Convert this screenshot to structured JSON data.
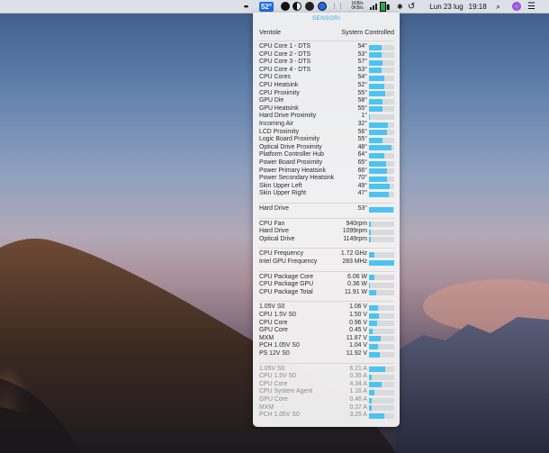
{
  "menubar": {
    "more_glyph": "••",
    "temp": "52°",
    "net_up": "1KB/s",
    "net_down": "0KB/s",
    "date": "Lun 23 lug",
    "time": "19:18",
    "icons": [
      "more-icon",
      "temperature-badge",
      "clock-icon",
      "theme-icon",
      "disk-icon",
      "globe-icon",
      "cpu-icon",
      "network-icon",
      "signal-icon",
      "battery-icon",
      "memory-icon",
      "bluetooth-icon",
      "timemachine-icon",
      "search-icon",
      "siri-icon",
      "notifications-icon"
    ]
  },
  "popup": {
    "title": "SENSORI",
    "fan_label": "Ventole",
    "fan_mode": "System Controlled",
    "groups": [
      {
        "rows": [
          {
            "label": "CPU Core 1 - DTS",
            "value": "54°",
            "level": 0.5
          },
          {
            "label": "CPU Core 2 - DTS",
            "value": "53°",
            "level": 0.49
          },
          {
            "label": "CPU Core 3 - DTS",
            "value": "57°",
            "level": 0.52
          },
          {
            "label": "CPU Core 4 - DTS",
            "value": "53°",
            "level": 0.49
          },
          {
            "label": "CPU Cores",
            "value": "54°",
            "level": 0.62
          },
          {
            "label": "CPU Heatsink",
            "value": "52°",
            "level": 0.6
          },
          {
            "label": "CPU Proximity",
            "value": "55°",
            "level": 0.63
          },
          {
            "label": "GPU Die",
            "value": "58°",
            "level": 0.55
          },
          {
            "label": "GPU Heatsink",
            "value": "55°",
            "level": 0.53
          },
          {
            "label": "Hard Drive Proximity",
            "value": "1°",
            "level": 0.05
          },
          {
            "label": "Incoming Air",
            "value": "32°",
            "level": 0.75
          },
          {
            "label": "LCD Proximity",
            "value": "56°",
            "level": 0.7
          },
          {
            "label": "Logic Board Proximity",
            "value": "55°",
            "level": 0.55
          },
          {
            "label": "Optical Drive Proximity",
            "value": "48°",
            "level": 0.9
          },
          {
            "label": "Platform Controller Hub",
            "value": "64°",
            "level": 0.62
          },
          {
            "label": "Power Board Proximity",
            "value": "65°",
            "level": 0.68
          },
          {
            "label": "Power Primary Heatsink",
            "value": "66°",
            "level": 0.72
          },
          {
            "label": "Power Secondary Heatsink",
            "value": "70°",
            "level": 0.7
          },
          {
            "label": "Skin Upper Left",
            "value": "49°",
            "level": 0.82
          },
          {
            "label": "Skin Upper Right",
            "value": "47°",
            "level": 0.8
          }
        ]
      },
      {
        "rows": [
          {
            "label": "Hard Drive",
            "value": "53°",
            "level": 0.95
          }
        ]
      },
      {
        "rows": [
          {
            "label": "CPU Fan",
            "value": "940rpm",
            "level": 0.06
          },
          {
            "label": "Hard Drive",
            "value": "1099rpm",
            "level": 0.06
          },
          {
            "label": "Optical Drive",
            "value": "1149rpm",
            "level": 0.06
          }
        ]
      },
      {
        "rows": [
          {
            "label": "CPU Frequency",
            "value": "1.72 GHz",
            "level": 0.2
          },
          {
            "label": "Intel GPU Frequency",
            "value": "283 MHz",
            "level": 1.0
          }
        ]
      },
      {
        "rows": [
          {
            "label": "CPU Package Core",
            "value": "6.06 W",
            "level": 0.2
          },
          {
            "label": "CPU Package GPU",
            "value": "0.36 W",
            "level": 0.04
          },
          {
            "label": "CPU Package Total",
            "value": "11.91 W",
            "level": 0.3
          }
        ]
      },
      {
        "rows": [
          {
            "label": "1.05V S0",
            "value": "1.06 V",
            "level": 0.35
          },
          {
            "label": "CPU 1.5V S0",
            "value": "1.50 V",
            "level": 0.4
          },
          {
            "label": "CPU Core",
            "value": "0.96 V",
            "level": 0.32
          },
          {
            "label": "GPU Core",
            "value": "0.45 V",
            "level": 0.15
          },
          {
            "label": "MXM",
            "value": "11.87 V",
            "level": 0.45
          },
          {
            "label": "PCH 1.05V S0",
            "value": "1.04 V",
            "level": 0.34
          },
          {
            "label": "PS 12V S0",
            "value": "11.92 V",
            "level": 0.42
          }
        ]
      },
      {
        "dim": true,
        "rows": [
          {
            "label": "1.05V S0",
            "value": "6.21 A",
            "level": 0.65
          },
          {
            "label": "CPU 1.5V S0",
            "value": "0.35 A",
            "level": 0.1
          },
          {
            "label": "CPU Core",
            "value": "4.34 A",
            "level": 0.5
          },
          {
            "label": "CPU System Agent",
            "value": "1.16 A",
            "level": 0.2
          },
          {
            "label": "GPU Core",
            "value": "0.46 A",
            "level": 0.1
          },
          {
            "label": "MXM",
            "value": "0.37 A",
            "level": 0.1
          },
          {
            "label": "PCH 1.05V S0",
            "value": "3.25 A",
            "level": 0.6
          }
        ]
      }
    ]
  }
}
